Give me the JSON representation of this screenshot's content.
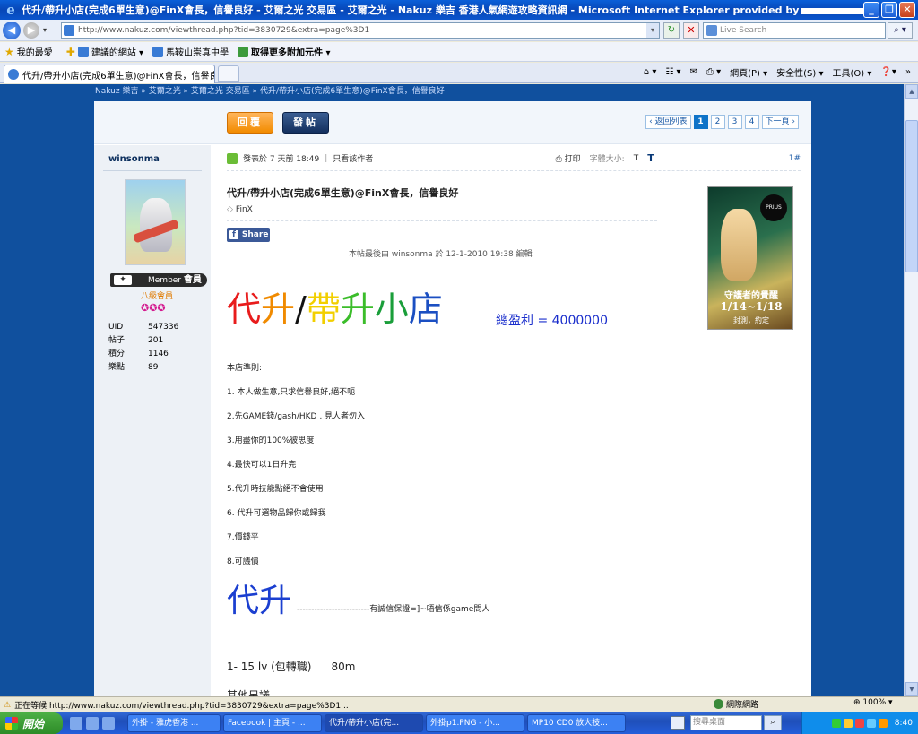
{
  "window": {
    "title": "代升/帶升小店(完成6單生意)@FinX會長，信譽良好 - 艾爾之光 交易區 - 艾爾之光 - Nakuz 樂吉 香港人氣網遊攻略資訊網 - Microsoft Internet Explorer provided by",
    "controls": [
      "_",
      "❐",
      "✕"
    ]
  },
  "addressbar": {
    "url": "http://www.nakuz.com/viewthread.php?tid=3830729&extra=page%3D1",
    "search_placeholder": "Live Search"
  },
  "favorites": {
    "label": "我的最愛",
    "items": [
      "建議的網站 ▾",
      "馬鞍山崇真中學",
      "取得更多附加元件 ▾"
    ]
  },
  "tabs": [
    {
      "label": "代升/帶升小店(完成6單生意)@FinX會長，信譽良..."
    }
  ],
  "commands": {
    "page": "網頁(P) ▾",
    "safety": "安全性(S) ▾",
    "tools": "工具(O) ▾",
    "help": "▾"
  },
  "breadcrumb": "Nakuz 樂吉 » 艾爾之光 » 艾爾之光 交易區 » 代升/帶升小店(完成6單生意)@FinX會長，信譽良好",
  "toolbar": {
    "reply": "回覆",
    "post": "發帖",
    "back_to_list": "‹ 返回列表",
    "pages": [
      "1",
      "2",
      "3",
      "4"
    ],
    "next": "下一頁 ›"
  },
  "author": {
    "name": "winsonma",
    "badge_en": "Member",
    "badge_zh": "會員",
    "rank": "八級會員",
    "stars": "✪✪✪",
    "stats": [
      {
        "k": "UID",
        "v": "547336"
      },
      {
        "k": "帖子",
        "v": "201"
      },
      {
        "k": "積分",
        "v": "1146"
      },
      {
        "k": "樂點",
        "v": "89"
      }
    ]
  },
  "post": {
    "posted": "發表於 7 天前 18:49",
    "only_author": "只看該作者",
    "print": "打印",
    "font_size": "字體大小:",
    "font_small": "T",
    "font_large": "T",
    "floor": "1#",
    "title": "代升/帶升小店(完成6單生意)@FinX會長，信譽良好",
    "tag": "FinX",
    "share": "Share",
    "edited": "本帖最後由 winsonma 於 12-1-2010 19:38 編輯",
    "banner": {
      "p1": "代",
      "p2": "升",
      "p3": "/",
      "p4": "帶",
      "p5": "升",
      "p6": "小",
      "p7": "店"
    },
    "profit": "總盈利 = 4000000",
    "rules_title": "本店準則:",
    "rules": [
      "1. 本人做生意,只求信譽良好,絕不呃",
      "2.先GAME錢/gash/HKD , 見人者勿入",
      "3.用盡你的100%彼思度",
      "4.最快可以1日升完",
      "5.代升時技能點絕不會使用",
      "6. 代升可選物品歸你或歸我",
      "7.價錢平",
      "8.可議價"
    ],
    "big2": "代升",
    "big2_after": "-------------------------有誠信保證=]~唔信係game問人",
    "level": "1- 15 lv (包轉職)",
    "price": "80m",
    "other": "其他另議"
  },
  "ad": {
    "logo": "PRIUS",
    "line1": "守護者的覺醒",
    "line2": "1/14~1/18",
    "line3": "封測，約定"
  },
  "statusbar": {
    "text": "正在等候 http://www.nakuz.com/viewthread.php?tid=3830729&extra=page%3D1...",
    "zone": "網際網路",
    "zoom": "100% ▾"
  },
  "taskbar": {
    "start": "開始",
    "tasks": [
      "外掛 - 雅虎香港 ...",
      "Facebook | 主頁 - ...",
      "代升/帶升小店(完...",
      "外掛p1.PNG - 小...",
      "MP10 CD0 放大技..."
    ],
    "search_placeholder": "搜尋桌面",
    "clock": "8:40"
  }
}
